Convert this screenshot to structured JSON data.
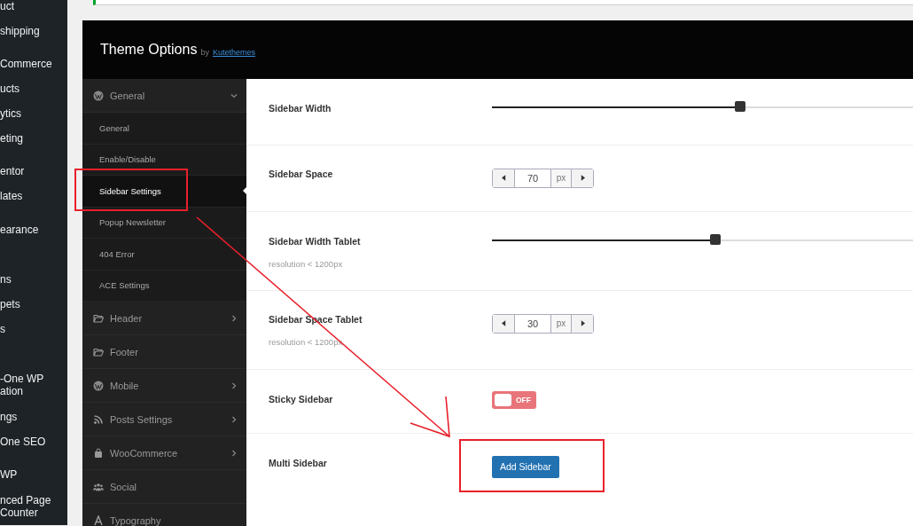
{
  "admin_menu": {
    "items": [
      {
        "label": "uct"
      },
      {
        "label": "shipping"
      },
      {
        "label": "Commerce"
      },
      {
        "label": "ucts"
      },
      {
        "label": "ytics"
      },
      {
        "label": "eting"
      },
      {
        "label": "entor"
      },
      {
        "label": "lates"
      },
      {
        "label": "earance"
      },
      {
        "label": "ns"
      },
      {
        "label": "pets"
      },
      {
        "label": "s"
      },
      {
        "label": "-One WP ation"
      },
      {
        "label": "ngs"
      },
      {
        "label": "One SEO"
      },
      {
        "label": "WP"
      },
      {
        "label": "nced Page Counter"
      }
    ]
  },
  "header": {
    "title": "Theme Options",
    "by": "by",
    "author": "Kutethemes"
  },
  "nav": [
    {
      "label": "General",
      "expanded": true,
      "has_children": true,
      "children": [
        {
          "label": "General",
          "selected": false
        },
        {
          "label": "Enable/Disable",
          "selected": false
        },
        {
          "label": "Sidebar Settings",
          "selected": true
        },
        {
          "label": "Popup Newsletter",
          "selected": false
        },
        {
          "label": "404 Error",
          "selected": false
        },
        {
          "label": "ACE Settings",
          "selected": false
        }
      ]
    },
    {
      "label": "Header",
      "expanded": false,
      "has_children": true
    },
    {
      "label": "Footer",
      "has_children": false
    },
    {
      "label": "Mobile",
      "expanded": false,
      "has_children": true
    },
    {
      "label": "Posts Settings",
      "expanded": false,
      "has_children": true
    },
    {
      "label": "WooCommerce",
      "expanded": false,
      "has_children": true
    },
    {
      "label": "Social",
      "has_children": false
    },
    {
      "label": "Typography",
      "has_children": false
    }
  ],
  "settings": [
    {
      "kind": "slider",
      "label": "Sidebar Width",
      "level": 0.59
    },
    {
      "kind": "stepper",
      "label": "Sidebar Space",
      "value": "70",
      "unit": "px"
    },
    {
      "kind": "slider",
      "label": "Sidebar Width Tablet",
      "note": "resolution < 1200px",
      "level": 0.53
    },
    {
      "kind": "stepper",
      "label": "Sidebar Space Tablet",
      "note": "resolution < 1200px",
      "value": "30",
      "unit": "px"
    },
    {
      "kind": "toggle",
      "label": "Sticky Sidebar",
      "on": false,
      "off_text": "OFF"
    },
    {
      "kind": "button",
      "label": "Multi Sidebar",
      "button": "Add Sidebar"
    }
  ]
}
